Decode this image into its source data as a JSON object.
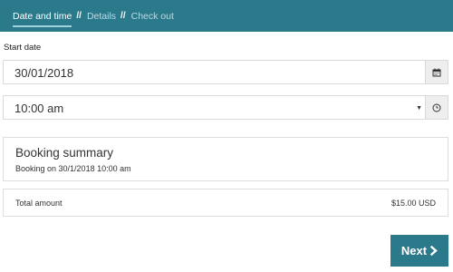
{
  "steps": [
    {
      "label": "Date and time",
      "active": true
    },
    {
      "label": "Details",
      "active": false
    },
    {
      "label": "Check out",
      "active": false
    }
  ],
  "separator": "//",
  "start_date": {
    "label": "Start date",
    "value": "30/01/2018",
    "icon": "calendar-icon"
  },
  "time": {
    "value": "10:00 am",
    "icon": "clock-icon"
  },
  "summary": {
    "title": "Booking summary",
    "text": "Booking on 30/1/2018 10:00 am"
  },
  "total": {
    "label": "Total amount",
    "value": "$15.00 USD"
  },
  "next_button": {
    "label": "Next",
    "icon": "chevron-right-icon"
  },
  "colors": {
    "brand": "#2b7a8c",
    "active_underline": "#9fd2df",
    "inactive_step": "#b9dbe3"
  }
}
